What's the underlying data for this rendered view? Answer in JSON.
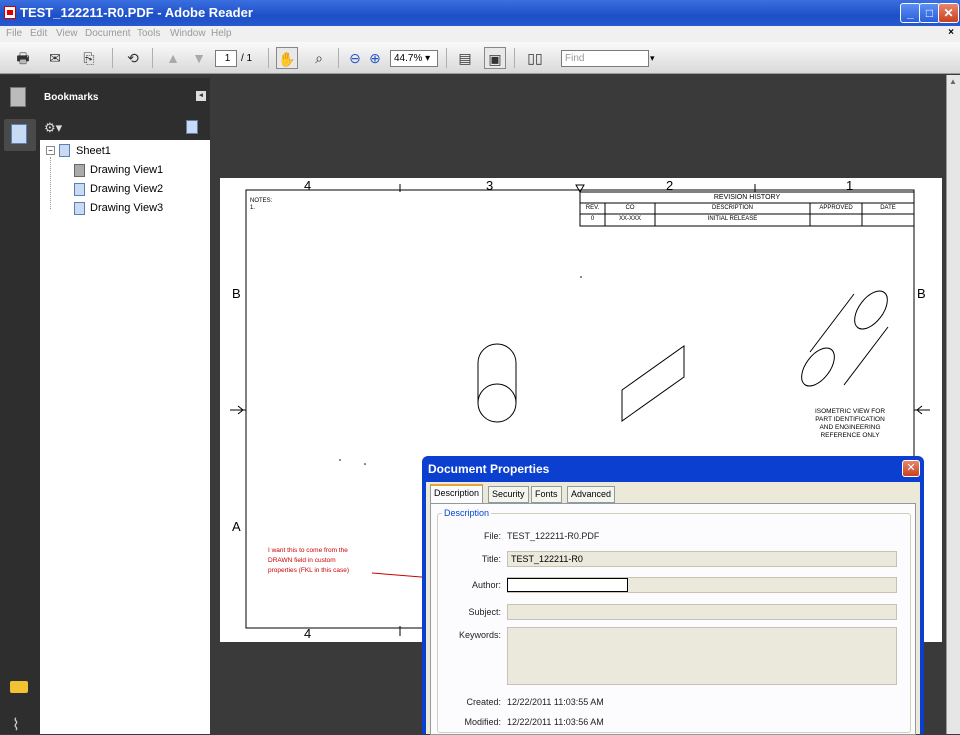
{
  "window": {
    "title": "TEST_122211-R0.PDF - Adobe Reader",
    "min": "_",
    "max": "□",
    "close": "✕"
  },
  "menu": {
    "items": [
      "File",
      "Edit",
      "View",
      "Document",
      "Tools",
      "Window",
      "Help"
    ],
    "close": "×"
  },
  "toolbar": {
    "page_current": "1",
    "page_total": "/ 1",
    "zoom": "44.7%",
    "find_placeholder": "Find"
  },
  "bookmarks": {
    "title": "Bookmarks",
    "items": [
      {
        "label": "Sheet1"
      },
      {
        "label": "Drawing View1"
      },
      {
        "label": "Drawing View2"
      },
      {
        "label": "Drawing View3"
      }
    ]
  },
  "drawing": {
    "zones_top": [
      "4",
      "3",
      "2",
      "1"
    ],
    "zones_bottom": [
      "4"
    ],
    "rows": [
      "B",
      "A"
    ],
    "notes": "NOTES:",
    "notes_item": "1.",
    "revision": {
      "title": "REVISION HISTORY",
      "headers": [
        "REV.",
        "CO",
        "DESCRIPTION",
        "APPROVED",
        "DATE"
      ],
      "row": [
        "0",
        "XX-XXX",
        "INITIAL RELEASE",
        "",
        ""
      ]
    },
    "iso_note": [
      "ISOMETRIC VIEW FOR",
      "PART IDENTIFICATION",
      "AND ENGINEERING",
      "REFERENCE ONLY"
    ],
    "annotation": [
      "I want this to come from the",
      "DRAWN field in custom",
      "properties (FKL in this case)"
    ]
  },
  "dialog": {
    "title": "Document Properties",
    "tabs": [
      "Description",
      "Security",
      "Fonts",
      "Advanced"
    ],
    "section": "Description",
    "fields": {
      "file_label": "File:",
      "file_value": "TEST_122211-R0.PDF",
      "title_label": "Title:",
      "title_value": "TEST_122211-R0",
      "author_label": "Author:",
      "author_value": "",
      "subject_label": "Subject:",
      "subject_value": "",
      "keywords_label": "Keywords:",
      "keywords_value": "",
      "created_label": "Created:",
      "created_value": "12/22/2011 11:03:55 AM",
      "modified_label": "Modified:",
      "modified_value": "12/22/2011 11:03:56 AM"
    }
  }
}
